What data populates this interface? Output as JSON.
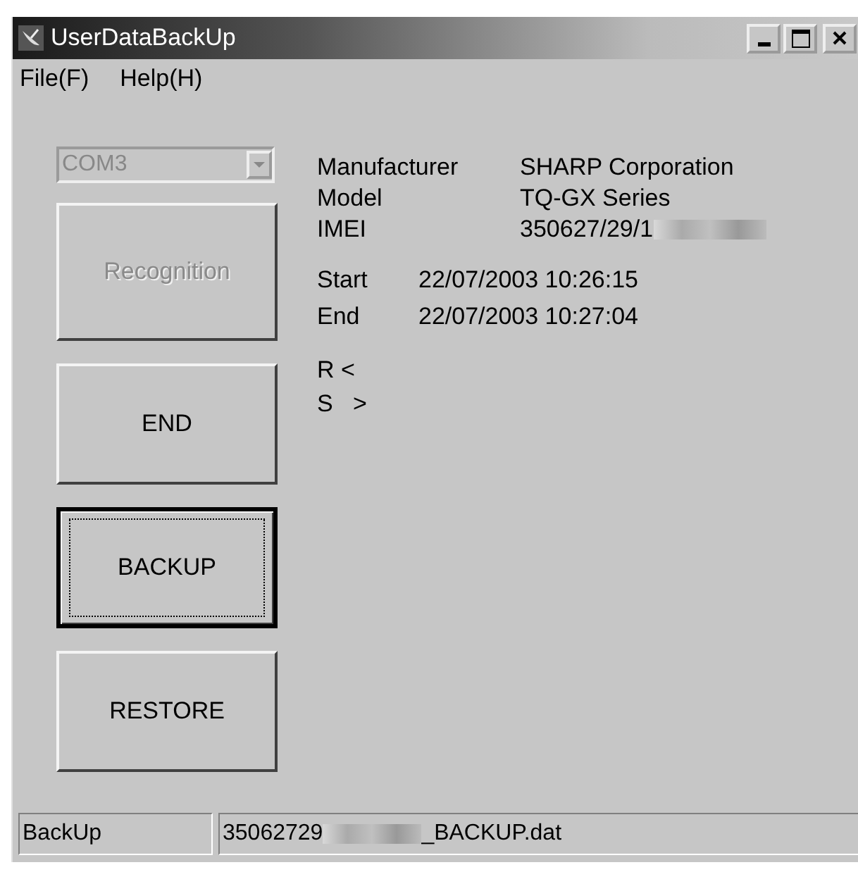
{
  "window": {
    "title": "UserDataBackUp"
  },
  "menu": [
    {
      "label": "File(F)"
    },
    {
      "label": "Help(H)"
    }
  ],
  "port": {
    "value": "COM3",
    "disabled": true
  },
  "buttons": [
    {
      "label": "Recognition",
      "disabled": true,
      "focused": false
    },
    {
      "label": "END",
      "disabled": false,
      "focused": false
    },
    {
      "label": "BACKUP",
      "disabled": false,
      "focused": true
    },
    {
      "label": "RESTORE",
      "disabled": false,
      "focused": false
    }
  ],
  "device": [
    {
      "label": "Manufacturer",
      "parts": [
        {
          "kind": "text",
          "text": "SHARP Corporation"
        }
      ]
    },
    {
      "label": "Model",
      "parts": [
        {
          "kind": "text",
          "text": "TQ-GX Series"
        }
      ]
    },
    {
      "label": "IMEI",
      "parts": [
        {
          "kind": "text",
          "text": "350627/29/1"
        },
        {
          "kind": "redacted"
        }
      ]
    }
  ],
  "times": [
    {
      "label": "Start",
      "value": "22/07/2003 10:26:15"
    },
    {
      "label": "End",
      "value": "22/07/2003 10:27:04"
    }
  ],
  "transfer": [
    {
      "text": "R <"
    },
    {
      "text": "S   >"
    }
  ],
  "status_bar": [
    {
      "parts": [
        {
          "kind": "text",
          "text": "BackUp"
        }
      ]
    },
    {
      "parts": [
        {
          "kind": "text",
          "text": "35062729"
        },
        {
          "kind": "redacted"
        },
        {
          "kind": "text",
          "text": "_BACKUP.dat"
        }
      ]
    }
  ]
}
